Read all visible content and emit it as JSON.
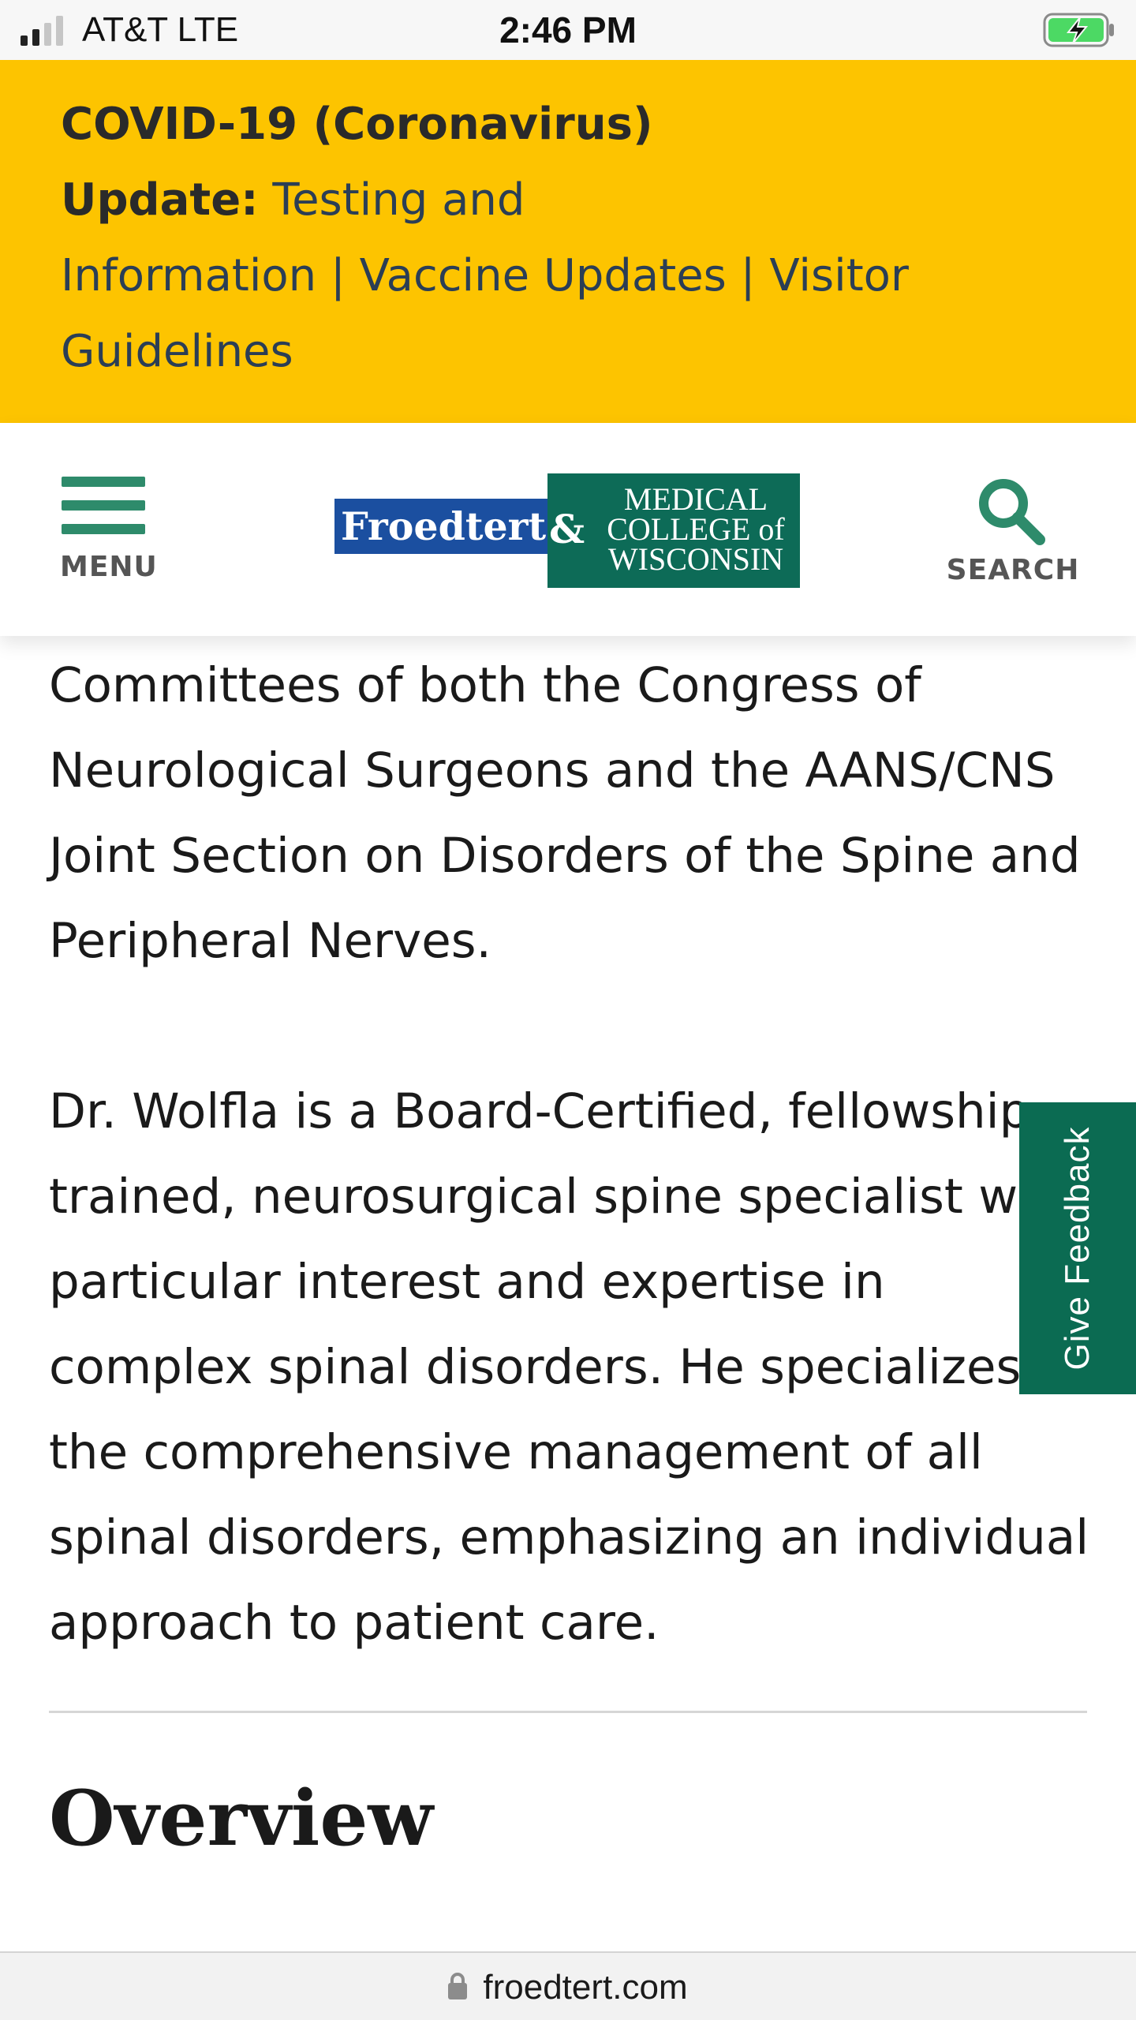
{
  "status_bar": {
    "carrier": "AT&T   LTE",
    "time": "2:46 PM",
    "signal_bars_active": 2,
    "signal_bars_total": 4,
    "battery_state": "charging",
    "battery_color": "#4cd964"
  },
  "covid_banner": {
    "title_bold": "COVID-19 (Coronavirus)",
    "update_label": "Update:",
    "link1": "Testing and",
    "link2": "Information",
    "sep": "|",
    "link3": "Vaccine Updates",
    "link4": "Visitor",
    "link5": "Guidelines",
    "background": "#fdc400"
  },
  "header": {
    "menu_label": "MENU",
    "search_label": "SEARCH",
    "logo": {
      "froedtert": "Froedtert",
      "amp": "&",
      "mcw_line1": "MEDICAL",
      "mcw_line2": "COLLEGE of",
      "mcw_line3": "WISCONSIN"
    },
    "accent": "#2e8b6b"
  },
  "content": {
    "paragraph1": "Committees of both the Congress of Neurological Surgeons and the AANS/CNS Joint Section on Disorders of the Spine and Peripheral Nerves.",
    "paragraph2": "Dr. Wolfla is a Board-Certified, fellowship-trained, neurosurgical spine specialist with particular interest and expertise in complex spinal disorders. He specializes in the comprehensive management of all spinal disorders, emphasizing an individual approach to patient care.",
    "section_heading": "Overview"
  },
  "feedback_tab": {
    "label": "Give Feedback",
    "background": "#0b6b52"
  },
  "url_bar": {
    "domain": "froedtert.com",
    "icon": "lock-icon"
  }
}
